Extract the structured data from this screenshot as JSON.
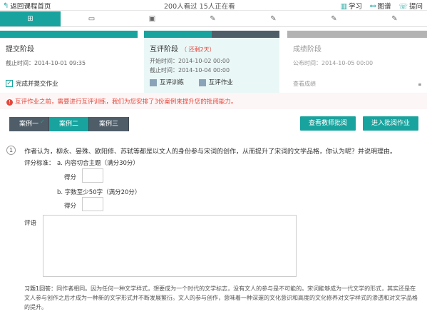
{
  "topbar": {
    "back_label": "返回课程首页",
    "viewers": "200人看过 15人正在看",
    "links": [
      {
        "icon": "book-icon",
        "label": "学习"
      },
      {
        "icon": "graph-icon",
        "label": "图谱"
      },
      {
        "icon": "question-icon",
        "label": "提问"
      }
    ]
  },
  "tabs": [
    {
      "icon": "grid-icon",
      "active": true
    },
    {
      "icon": "chat-icon",
      "active": false
    },
    {
      "icon": "image-icon",
      "active": false
    },
    {
      "icon": "pencil-icon",
      "active": false
    },
    {
      "icon": "pencil-icon",
      "active": false
    },
    {
      "icon": "pencil-icon",
      "active": false
    },
    {
      "icon": "pencil-icon",
      "active": false
    }
  ],
  "stages": {
    "submit": {
      "title": "提交阶段",
      "deadline": "截止时间：2014-10-01 09:35",
      "check_label": "完成并提交作业"
    },
    "peer": {
      "title": "互评阶段",
      "remaining": "（ 还剩2天）",
      "start": "开始时间：2014-10-02 00:00",
      "deadline": "截止时间：2014-10-04 00:00",
      "item1": "互评训练",
      "item2": "互评作业"
    },
    "score": {
      "title": "成绩阶段",
      "publish": "公布时间：2014-10-05 00:00",
      "view_label": "查看成绩"
    }
  },
  "notice": "互评作业之前，需要进行互评训练，我们为您安排了3份案例来提升您的批阅能力。",
  "cases": [
    "案例一",
    "案例二",
    "案例三"
  ],
  "buttons": {
    "teacher_review": "查看教师批阅",
    "enter_review": "进入批阅作业"
  },
  "question": {
    "number": "1",
    "text": "作者认为，柳永、晏殊、欧阳修、苏轼等都是以文人的身份参与宋词的创作，从而提升了宋词的文学品格，你认为呢？并说明理由。",
    "criteria_label": "评分标准：",
    "criterion_a": "a. 内容切合主题（满分30分）",
    "criterion_b": "b. 字数至少50字（满分20分）",
    "score_label": "得分",
    "review_label": "评语"
  },
  "answer": {
    "label": "习题1回答：",
    "text": "同作者相同。因为任何一种文学样式，想要成为一个时代的文学标志，没有文人的参与是不可能的。宋词能够成为一代文学的形式，其实还是在文人参与创作之后才成为一种新的文学形式并不断发展繁衍。文人的参与创作，意味着一种深邃的文化意识和高度的文化修养对文学样式的渗透和对文学品格的提升。"
  },
  "colors": {
    "accent": "#19a39e",
    "dark": "#4f5d69",
    "danger": "#e5473c",
    "gray": "#b3b3b3"
  }
}
